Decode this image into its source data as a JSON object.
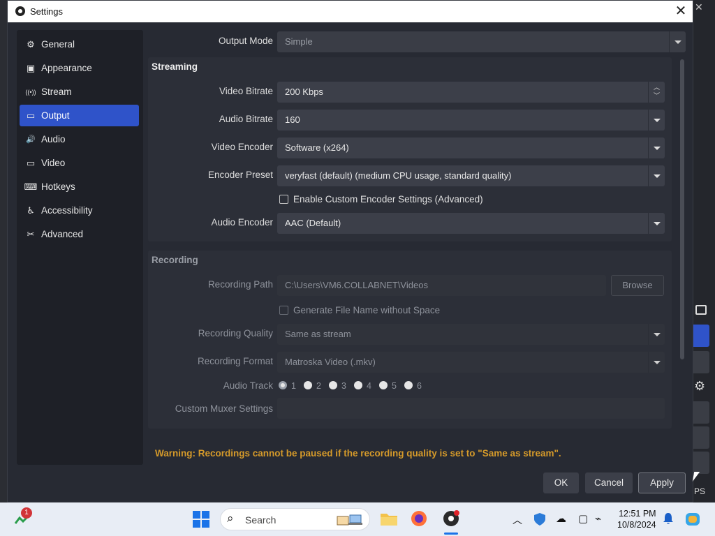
{
  "background": {
    "close_glyph": "✕",
    "status_text": "PS"
  },
  "window": {
    "title": "Settings",
    "close_glyph": "✕"
  },
  "sidebar": {
    "items": [
      {
        "label": "General",
        "icon": "gear-icon",
        "glyph": "⚙"
      },
      {
        "label": "Appearance",
        "icon": "appearance-icon",
        "glyph": "▣"
      },
      {
        "label": "Stream",
        "icon": "antenna-icon",
        "glyph": "((•))"
      },
      {
        "label": "Output",
        "icon": "monitor-icon",
        "glyph": "▭",
        "active": true
      },
      {
        "label": "Audio",
        "icon": "speaker-icon",
        "glyph": "🔊"
      },
      {
        "label": "Video",
        "icon": "display-icon",
        "glyph": "▭"
      },
      {
        "label": "Hotkeys",
        "icon": "keyboard-icon",
        "glyph": "⌨"
      },
      {
        "label": "Accessibility",
        "icon": "accessibility-icon",
        "glyph": "♿"
      },
      {
        "label": "Advanced",
        "icon": "tools-icon",
        "glyph": "✂"
      }
    ]
  },
  "output_mode": {
    "label": "Output Mode",
    "value": "Simple"
  },
  "streaming": {
    "title": "Streaming",
    "video_bitrate": {
      "label": "Video Bitrate",
      "value": "200 Kbps"
    },
    "audio_bitrate": {
      "label": "Audio Bitrate",
      "value": "160"
    },
    "video_encoder": {
      "label": "Video Encoder",
      "value": "Software (x264)"
    },
    "encoder_preset": {
      "label": "Encoder Preset",
      "value": "veryfast (default) (medium CPU usage, standard quality)"
    },
    "custom_encoder": {
      "label": "Enable Custom Encoder Settings (Advanced)",
      "checked": false
    },
    "audio_encoder": {
      "label": "Audio Encoder",
      "value": "AAC (Default)"
    }
  },
  "recording": {
    "title": "Recording",
    "path": {
      "label": "Recording Path",
      "value": "C:\\Users\\VM6.COLLABNET\\Videos",
      "browse": "Browse"
    },
    "no_space": {
      "label": "Generate File Name without Space",
      "checked": false
    },
    "quality": {
      "label": "Recording Quality",
      "value": "Same as stream"
    },
    "format": {
      "label": "Recording Format",
      "value": "Matroska Video (.mkv)"
    },
    "audio_track": {
      "label": "Audio Track",
      "tracks": [
        "1",
        "2",
        "3",
        "4",
        "5",
        "6"
      ],
      "selected": "1"
    },
    "muxer": {
      "label": "Custom Muxer Settings",
      "value": ""
    }
  },
  "warning": "Warning: Recordings cannot be paused if the recording quality is set to \"Same as stream\".",
  "buttons": {
    "ok": "OK",
    "cancel": "Cancel",
    "apply": "Apply"
  },
  "taskbar": {
    "badge_count": "1",
    "search_placeholder": "Search",
    "time": "12:51 PM",
    "date": "10/8/2024"
  }
}
